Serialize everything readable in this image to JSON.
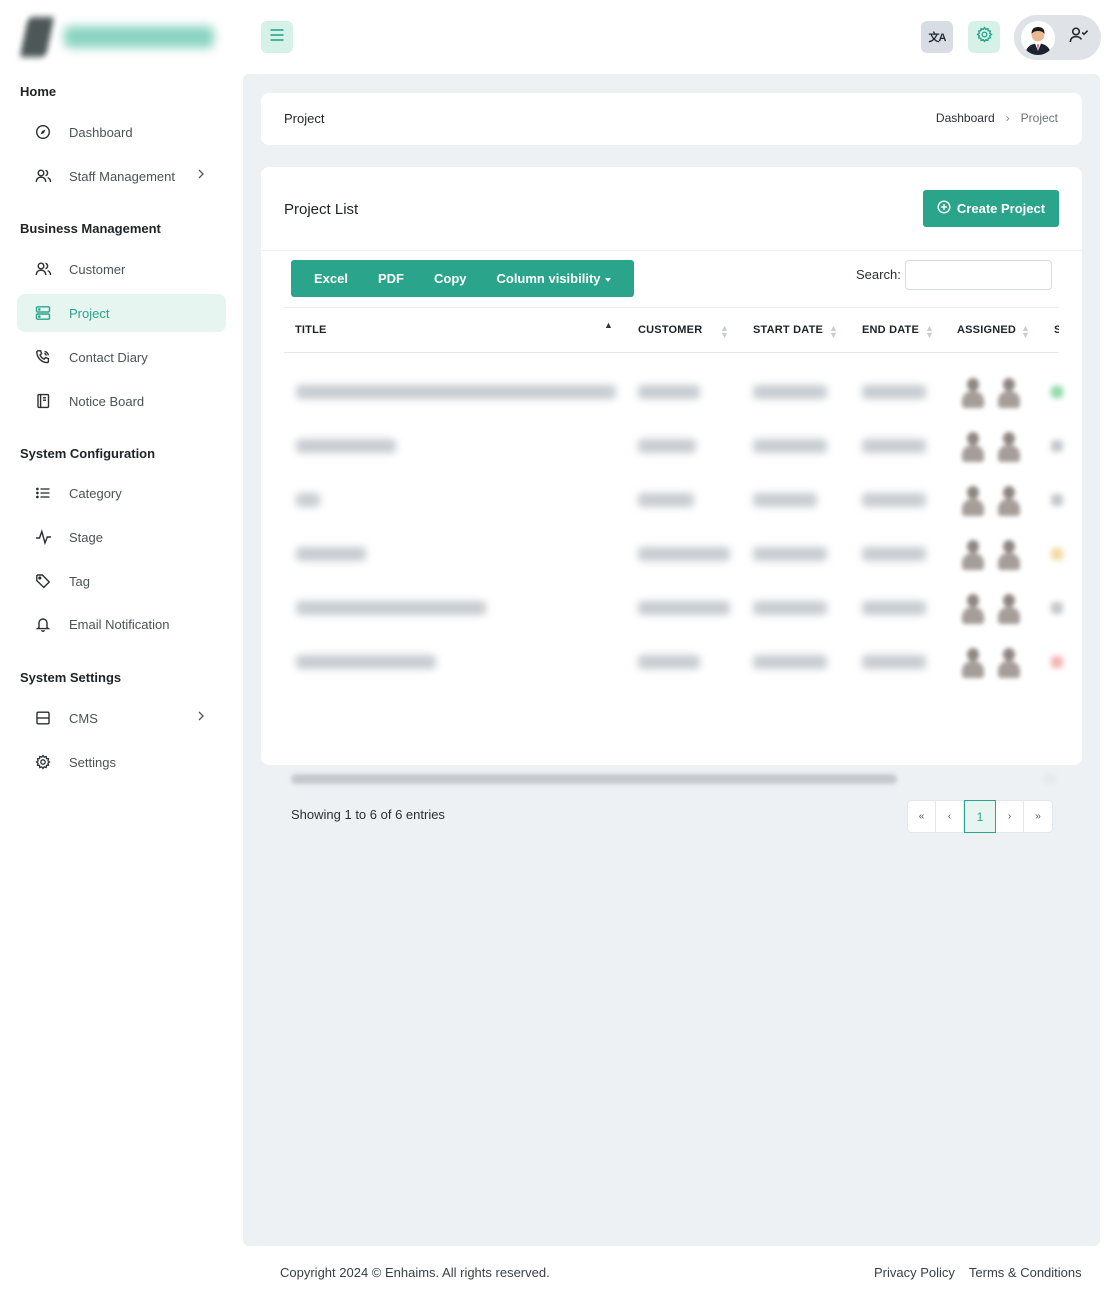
{
  "sidebar": {
    "sections": [
      {
        "heading": "Home",
        "items": [
          {
            "label": "Dashboard",
            "icon": "compass-icon"
          },
          {
            "label": "Staff Management",
            "icon": "users-icon",
            "has_submenu": true
          }
        ]
      },
      {
        "heading": "Business Management",
        "items": [
          {
            "label": "Customer",
            "icon": "users-icon"
          },
          {
            "label": "Project",
            "icon": "server-icon",
            "active": true
          },
          {
            "label": "Contact Diary",
            "icon": "phone-icon"
          },
          {
            "label": "Notice Board",
            "icon": "book-icon"
          }
        ]
      },
      {
        "heading": "System Configuration",
        "items": [
          {
            "label": "Category",
            "icon": "list-icon"
          },
          {
            "label": "Stage",
            "icon": "activity-icon"
          },
          {
            "label": "Tag",
            "icon": "tag-icon"
          },
          {
            "label": "Email Notification",
            "icon": "bell-icon"
          }
        ]
      },
      {
        "heading": "System Settings",
        "items": [
          {
            "label": "CMS",
            "icon": "layout-icon",
            "has_submenu": true
          },
          {
            "label": "Settings",
            "icon": "gear-icon"
          }
        ]
      }
    ]
  },
  "header": {
    "translate_label": "文A",
    "accent_color": "#2aa48a"
  },
  "breadcrumb": {
    "title": "Project",
    "items": [
      "Dashboard",
      "Project"
    ],
    "separator": "›"
  },
  "project_list": {
    "title": "Project List",
    "create_button": "Create Project",
    "export_buttons": [
      "Excel",
      "PDF",
      "Copy",
      "Column visibility"
    ],
    "search_label": "Search:",
    "search_value": "",
    "columns": [
      "TITLE",
      "CUSTOMER",
      "START DATE",
      "END DATE",
      "ASSIGNED",
      "S"
    ],
    "sorted_column": "TITLE",
    "row_count": 6,
    "status_colors": [
      "#8fd9a8",
      "#c3c8cc",
      "#c3c8cc",
      "#f5d9a0",
      "#c3c8cc",
      "#f3b3b3"
    ],
    "showing_text": "Showing 1 to 6 of 6 entries",
    "pagination": {
      "first": "«",
      "prev": "‹",
      "current": "1",
      "next": "›",
      "last": "»"
    }
  },
  "footer": {
    "copyright": "Copyright 2024 © Enhaims. All rights reserved.",
    "links": [
      "Privacy Policy",
      "Terms & Conditions"
    ]
  }
}
